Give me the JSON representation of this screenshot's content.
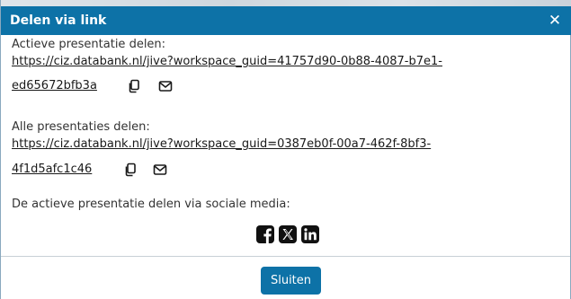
{
  "dialog": {
    "title": "Delen via link",
    "close_glyph": "✕"
  },
  "active": {
    "label": "Actieve presentatie delen:",
    "url_line1": "https://ciz.databank.nl/jive?workspace_guid=41757d90-0b88-4087-b7e1-",
    "url_line2": "ed65672bfb3a"
  },
  "all": {
    "label": "Alle presentaties delen:",
    "url_line1": "https://ciz.databank.nl/jive?workspace_guid=0387eb0f-00a7-462f-8bf3-",
    "url_line2": "4f1d5afc1c46"
  },
  "social": {
    "label": "De actieve presentatie delen via sociale media:",
    "icons": [
      "facebook-icon",
      "x-twitter-icon",
      "linkedin-icon"
    ]
  },
  "footer": {
    "close_button": "Sluiten"
  },
  "colors": {
    "header": "#0d72a7",
    "button": "#0d72a7",
    "text": "#333333"
  }
}
